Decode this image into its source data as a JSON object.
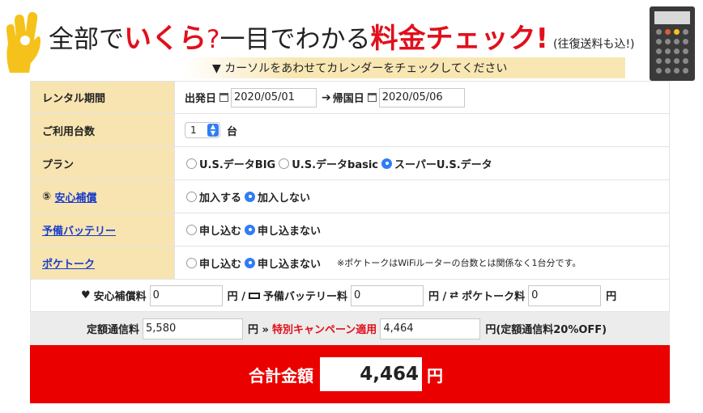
{
  "header": {
    "title_part1": "全部で",
    "title_part2": "いくら",
    "title_part3": "?",
    "title_part4": "一目でわかる",
    "title_part5": "料金チェック!",
    "title_part6": "(往復送料も込!)",
    "instruction": "▼ カーソルをあわせてカレンダーをチェックしてください",
    "hand_icon": "ok-hand-icon",
    "calc_icon": "calculator-icon",
    "hand_color": "#f4c21b"
  },
  "rental": {
    "label": "レンタル期間",
    "depart_label": "出発日",
    "depart_value": "2020/05/01",
    "arrow": "➔",
    "return_label": "帰国日",
    "return_value": "2020/05/06"
  },
  "units": {
    "label": "ご利用台数",
    "value": "1",
    "unit": "台"
  },
  "plan": {
    "label": "プラン",
    "options": [
      "U.S.データBIG",
      "U.S.データbasic",
      "スーパーU.S.データ"
    ],
    "selected_index": 2
  },
  "insurance": {
    "label_prefix": "⑤",
    "label": "安心補償",
    "options": [
      "加入する",
      "加入しない"
    ],
    "selected_index": 1
  },
  "battery": {
    "label": "予備バッテリー",
    "options": [
      "申し込む",
      "申し込まない"
    ],
    "selected_index": 1
  },
  "poketalk": {
    "label": "ポケトーク",
    "options": [
      "申し込む",
      "申し込まない"
    ],
    "selected_index": 1,
    "note": "※ポケトークはWiFiルーターの台数とは関係なく1台分です。"
  },
  "fees": {
    "insurance_label": "安心補償料",
    "insurance_value": "0",
    "yen1": "円 /",
    "battery_label": "予備バッテリー料",
    "battery_value": "0",
    "yen2": "円 /",
    "poketalk_label": "ポケトーク料",
    "poketalk_value": "0",
    "yen3": "円"
  },
  "pricing": {
    "regular_label": "定額通信料",
    "regular_value": "5,580",
    "yen_sep": "円 »",
    "campaign_label": "特別キャンペーン適用",
    "campaign_value": "4,464",
    "campaign_note": "円(定額通信料20%OFF)"
  },
  "total": {
    "label": "合計金額",
    "value": "4,464",
    "yen": "円"
  },
  "colors": {
    "accent_red": "#e0101c",
    "total_bg": "#eb0000",
    "label_bg": "#f7e4b1",
    "radio_on": "#2f7df6",
    "link": "#1a3cc8"
  }
}
